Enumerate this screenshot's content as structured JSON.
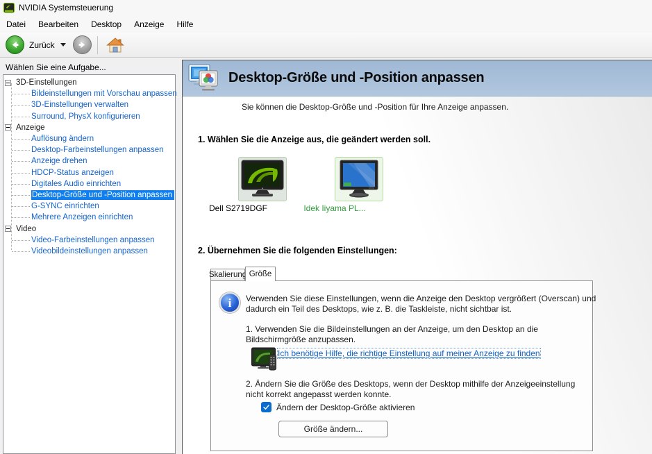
{
  "colors": {
    "nvidia_green": "#76b900",
    "selection_blue": "#0f7ff0",
    "tree_link_blue": "#1464cc",
    "link_blue": "#1464c8",
    "checkbox_blue": "#0b6cd0",
    "display_selected_green": "#2f9e3c",
    "banner_blue": "#a7bfda"
  },
  "window": {
    "title": "NVIDIA Systemsteuerung"
  },
  "menu": [
    "Datei",
    "Bearbeiten",
    "Desktop",
    "Anzeige",
    "Hilfe"
  ],
  "toolbar": {
    "back": "Zurück"
  },
  "sidebar": {
    "header": "Wählen Sie eine Aufgabe...",
    "groups": [
      {
        "label": "3D-Einstellungen",
        "items": [
          "Bildeinstellungen mit Vorschau anpassen",
          "3D-Einstellungen verwalten",
          "Surround, PhysX konfigurieren"
        ]
      },
      {
        "label": "Anzeige",
        "items": [
          "Auflösung ändern",
          "Desktop-Farbeinstellungen anpassen",
          "Anzeige drehen",
          "HDCP-Status anzeigen",
          "Digitales Audio einrichten",
          "Desktop-Größe und -Position anpassen",
          "G-SYNC einrichten",
          "Mehrere Anzeigen einrichten"
        ]
      },
      {
        "label": "Video",
        "items": [
          "Video-Farbeinstellungen anpassen",
          "Videobildeinstellungen anpassen"
        ]
      }
    ],
    "selected_item": "Desktop-Größe und -Position anpassen"
  },
  "page": {
    "title": "Desktop-Größe und -Position anpassen",
    "subtitle": "Sie können die Desktop-Größe und -Position für Ihre Anzeige anpassen."
  },
  "step1": {
    "heading": "1. Wählen Sie die Anzeige aus, die geändert werden soll.",
    "displays": [
      {
        "name": "Dell S2719DGF",
        "selected": false
      },
      {
        "name": "Idek Iiyama PL...",
        "selected": true
      }
    ]
  },
  "step2": {
    "heading": "2. Übernehmen Sie die folgenden Einstellungen:",
    "tabs": [
      {
        "label": "Skalierung",
        "active": false
      },
      {
        "label": "Größe",
        "active": true
      }
    ],
    "panel": {
      "info": "Verwenden Sie diese Einstellungen, wenn die Anzeige den Desktop vergrößert (Overscan) und dadurch ein Teil des Desktops, wie z. B. die Taskleiste, nicht sichtbar ist.",
      "instruction1": "1. Verwenden Sie die Bildeinstellungen an der Anzeige, um den Desktop an die Bildschirmgröße anzupassen.",
      "help_link": "Ich benötige Hilfe, die richtige Einstellung auf meiner Anzeige zu finden",
      "instruction2": "2. Ändern Sie die Größe des Desktops, wenn der Desktop mithilfe der Anzeigeeinstellung nicht korrekt angepasst werden konnte.",
      "checkbox": {
        "label": "Ändern der Desktop-Größe aktivieren",
        "checked": true
      },
      "button": "Größe ändern..."
    }
  }
}
